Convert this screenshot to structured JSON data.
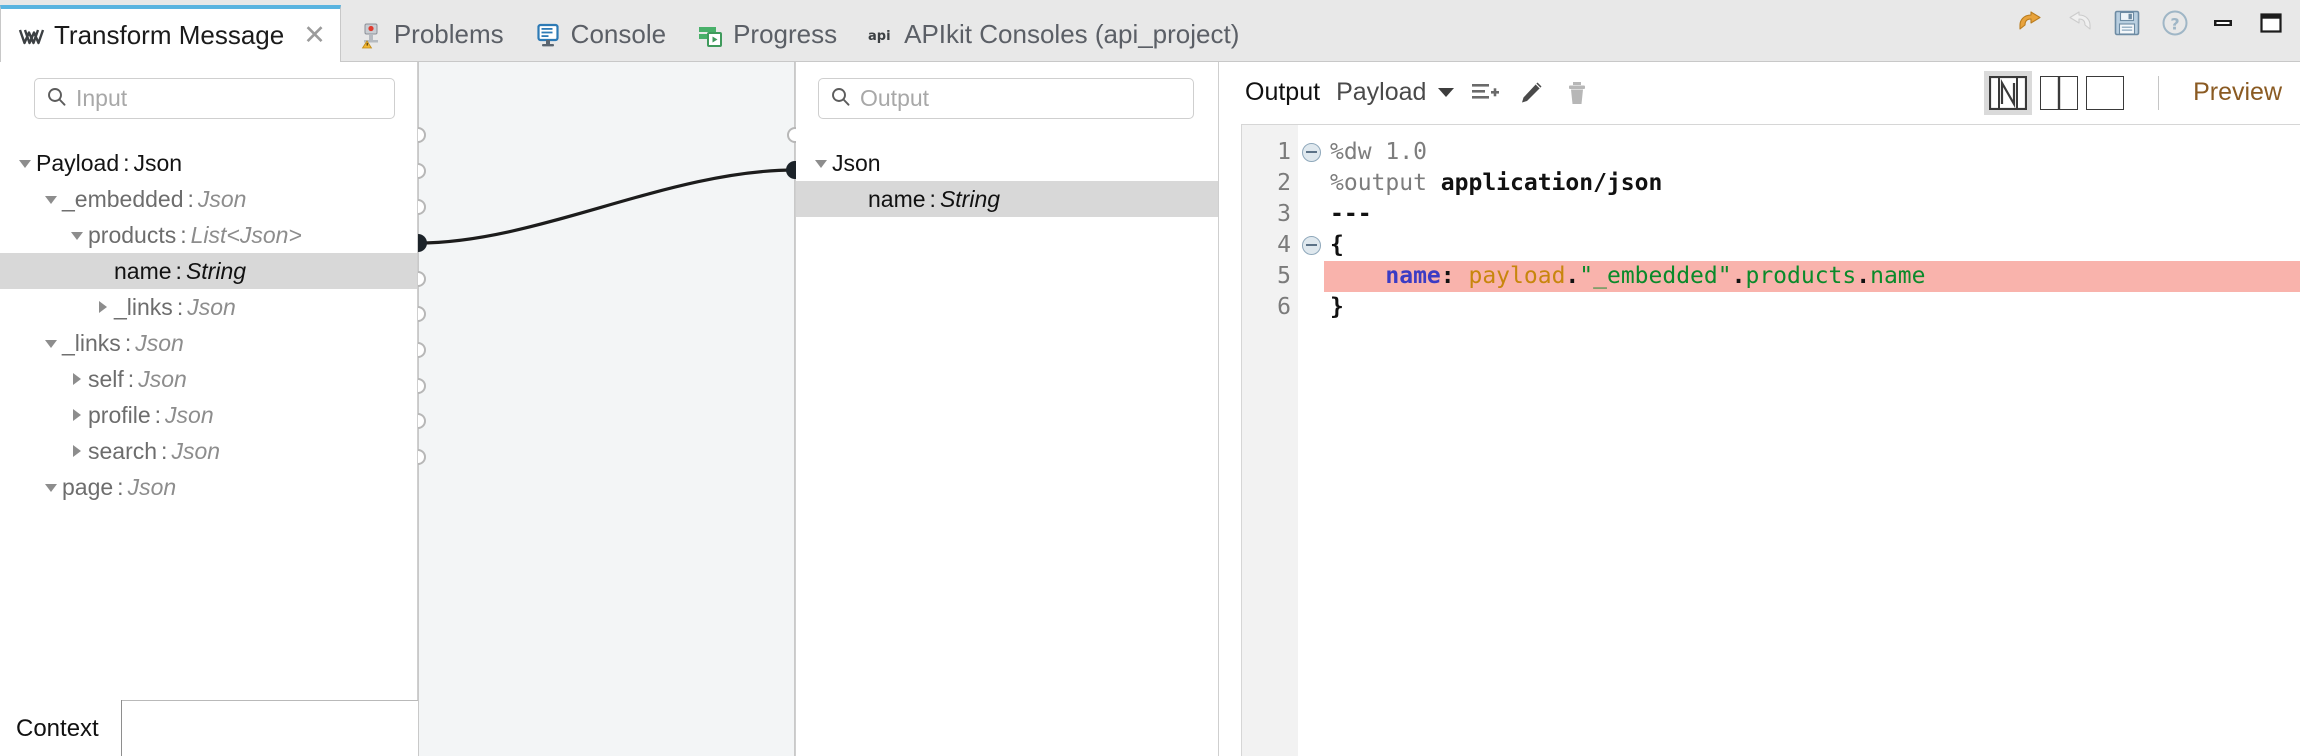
{
  "window": {
    "actions": [
      {
        "name": "undo-icon",
        "label": "Undo"
      },
      {
        "name": "redo-icon",
        "label": "Redo"
      },
      {
        "name": "save-icon",
        "label": "Save"
      },
      {
        "name": "help-icon",
        "label": "Help"
      },
      {
        "name": "minimize-icon",
        "label": "Minimize"
      },
      {
        "name": "maximize-icon",
        "label": "Maximize"
      }
    ]
  },
  "tabs": [
    {
      "label": "Transform Message",
      "icon": "mule-transform-icon",
      "active": true,
      "closable": true
    },
    {
      "label": "Problems",
      "icon": "problems-icon",
      "active": false,
      "closable": false
    },
    {
      "label": "Console",
      "icon": "console-icon",
      "active": false,
      "closable": false
    },
    {
      "label": "Progress",
      "icon": "progress-icon",
      "active": false,
      "closable": false
    },
    {
      "label": "APIkit Consoles (api_project)",
      "icon": "api-icon",
      "active": false,
      "closable": false
    }
  ],
  "input_panel": {
    "search_placeholder": "Input",
    "tree": [
      {
        "indent": 0,
        "expander": "down",
        "name": "Payload",
        "type": "Json",
        "root": true,
        "selected": false
      },
      {
        "indent": 1,
        "expander": "down",
        "name": "_embedded",
        "type": "Json",
        "root": false,
        "selected": false
      },
      {
        "indent": 2,
        "expander": "down",
        "name": "products",
        "type": "List<Json>",
        "root": false,
        "selected": false
      },
      {
        "indent": 3,
        "expander": "none",
        "name": "name",
        "type": "String",
        "root": false,
        "selected": true
      },
      {
        "indent": 3,
        "expander": "right",
        "name": "_links",
        "type": "Json",
        "root": false,
        "selected": false
      },
      {
        "indent": 1,
        "expander": "down",
        "name": "_links",
        "type": "Json",
        "root": false,
        "selected": false
      },
      {
        "indent": 2,
        "expander": "right",
        "name": "self",
        "type": "Json",
        "root": false,
        "selected": false
      },
      {
        "indent": 2,
        "expander": "right",
        "name": "profile",
        "type": "Json",
        "root": false,
        "selected": false
      },
      {
        "indent": 2,
        "expander": "right",
        "name": "search",
        "type": "Json",
        "root": false,
        "selected": false
      },
      {
        "indent": 1,
        "expander": "down",
        "name": "page",
        "type": "Json",
        "root": false,
        "selected": false
      }
    ],
    "bottom_tab": "Context"
  },
  "mapping": {
    "connections": [
      {
        "from": "payload._embedded.products.name",
        "to": "Json.name"
      }
    ]
  },
  "output_panel": {
    "search_placeholder": "Output",
    "tree": [
      {
        "indent": 0,
        "expander": "down",
        "name": "Json",
        "type": "",
        "root": true,
        "selected": false
      },
      {
        "indent": 1,
        "expander": "none",
        "name": "name",
        "type": "String",
        "root": false,
        "selected": true
      }
    ]
  },
  "code_panel": {
    "output_label": "Output",
    "target_selector": "Payload",
    "toolbar_icons": [
      {
        "name": "add-field-icon",
        "label": "New field"
      },
      {
        "name": "edit-icon",
        "label": "Edit"
      },
      {
        "name": "delete-icon",
        "label": "Delete"
      }
    ],
    "view_modes": [
      {
        "name": "view-mode-split-graphic",
        "active": true
      },
      {
        "name": "view-mode-two-column",
        "active": false
      },
      {
        "name": "view-mode-single",
        "active": false
      }
    ],
    "preview_label": "Preview",
    "lines": [
      {
        "num": "1",
        "fold": true,
        "highlight": false,
        "tokens": [
          {
            "t": "%dw ",
            "c": "c-grey"
          },
          {
            "t": "1.0",
            "c": "c-grey"
          }
        ]
      },
      {
        "num": "2",
        "fold": false,
        "highlight": false,
        "tokens": [
          {
            "t": "%output ",
            "c": "c-grey"
          },
          {
            "t": "application/json",
            "c": "c-black"
          }
        ]
      },
      {
        "num": "3",
        "fold": false,
        "highlight": false,
        "tokens": [
          {
            "t": "---",
            "c": "c-dark"
          }
        ]
      },
      {
        "num": "4",
        "fold": true,
        "highlight": false,
        "tokens": [
          {
            "t": "{",
            "c": "c-dark"
          }
        ]
      },
      {
        "num": "5",
        "fold": false,
        "highlight": true,
        "tokens": [
          {
            "t": "    ",
            "c": "c-dark"
          },
          {
            "t": "name",
            "c": "c-blue"
          },
          {
            "t": ": ",
            "c": "c-dark"
          },
          {
            "t": "payload",
            "c": "c-orange"
          },
          {
            "t": ".",
            "c": "c-dark"
          },
          {
            "t": "\"_embedded\"",
            "c": "c-green"
          },
          {
            "t": ".",
            "c": "c-dark"
          },
          {
            "t": "products",
            "c": "c-green"
          },
          {
            "t": ".",
            "c": "c-dark"
          },
          {
            "t": "name",
            "c": "c-green"
          }
        ]
      },
      {
        "num": "6",
        "fold": false,
        "highlight": false,
        "tokens": [
          {
            "t": "}",
            "c": "c-dark"
          }
        ]
      }
    ]
  },
  "colors": {
    "active_tab_accent": "#5ab4e0",
    "selection_grey": "#d8d8d8",
    "error_highlight": "#f9b3ac",
    "canvas_bg": "#f3f5f6",
    "preview_link": "#8a5a22"
  }
}
